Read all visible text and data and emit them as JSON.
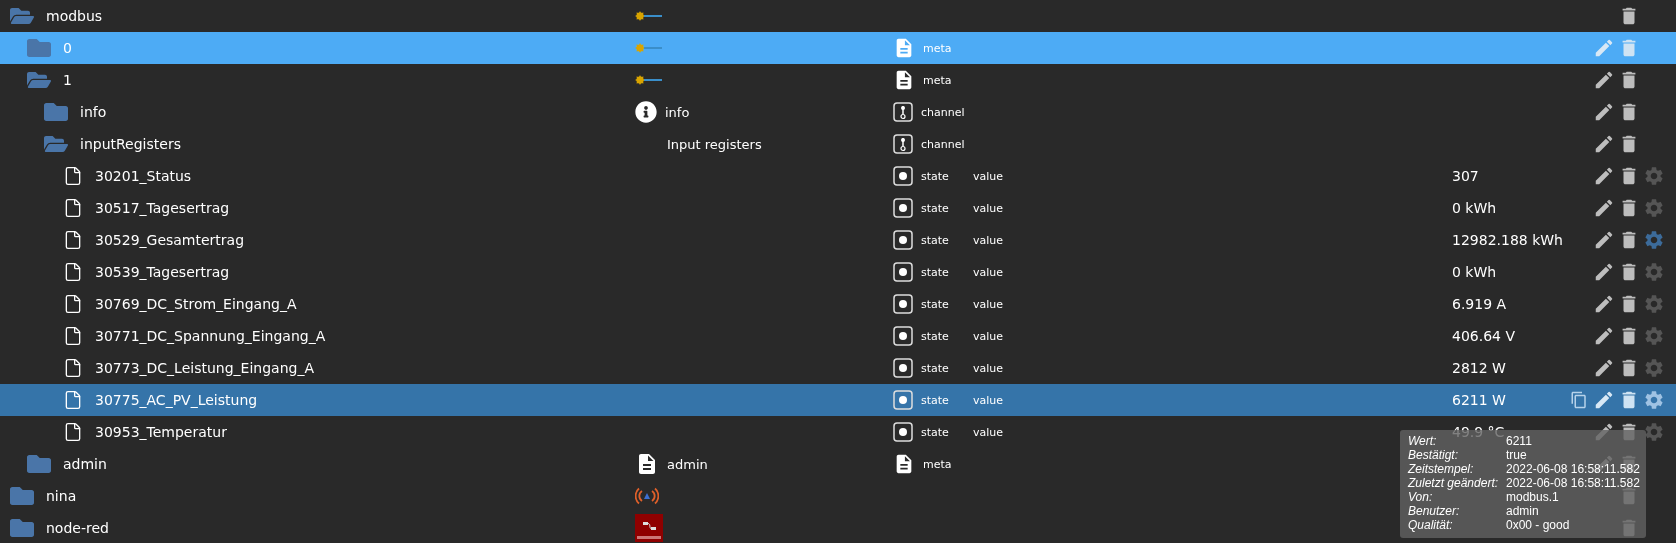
{
  "objects": [
    {
      "name": "modbus",
      "kind": "folder",
      "expanded": true,
      "selected": false,
      "hovered": false,
      "icon": {
        "kind": "logo"
      },
      "editable": false,
      "children": [
        {
          "name": "0",
          "kind": "folder",
          "expanded": false,
          "selected": true,
          "hovered": false,
          "icon": {
            "kind": "logo"
          },
          "type": {
            "kind": "meta",
            "label": "meta"
          },
          "editable": true
        },
        {
          "name": "1",
          "kind": "folder",
          "expanded": true,
          "selected": false,
          "hovered": false,
          "icon": {
            "kind": "logo"
          },
          "type": {
            "kind": "meta",
            "label": "meta"
          },
          "editable": true,
          "children": [
            {
              "name": "info",
              "kind": "folder",
              "expanded": false,
              "selected": false,
              "hovered": false,
              "icon": {
                "kind": "info",
                "label": "info"
              },
              "type": {
                "kind": "channel",
                "label": "channel"
              },
              "editable": true
            },
            {
              "name": "inputRegisters",
              "kind": "folder",
              "expanded": true,
              "selected": false,
              "hovered": false,
              "icon": {
                "kind": "none",
                "label": "Input registers"
              },
              "type": {
                "kind": "channel",
                "label": "channel"
              },
              "editable": true,
              "children": [
                {
                  "name": "30201_Status",
                  "kind": "state",
                  "selected": false,
                  "hovered": false,
                  "type": {
                    "kind": "state",
                    "label": "state"
                  },
                  "role": "value",
                  "value": "307",
                  "editable": true,
                  "settings": true,
                  "custom": false
                },
                {
                  "name": "30517_Tagesertrag",
                  "kind": "state",
                  "selected": false,
                  "hovered": false,
                  "type": {
                    "kind": "state",
                    "label": "state"
                  },
                  "role": "value",
                  "value": "0 kWh",
                  "editable": true,
                  "settings": true,
                  "custom": false
                },
                {
                  "name": "30529_Gesamtertrag",
                  "kind": "state",
                  "selected": false,
                  "hovered": false,
                  "type": {
                    "kind": "state",
                    "label": "state"
                  },
                  "role": "value",
                  "value": "12982.188 kWh",
                  "editable": true,
                  "settings": true,
                  "custom": true
                },
                {
                  "name": "30539_Tagesertrag",
                  "kind": "state",
                  "selected": false,
                  "hovered": false,
                  "type": {
                    "kind": "state",
                    "label": "state"
                  },
                  "role": "value",
                  "value": "0 kWh",
                  "editable": true,
                  "settings": true,
                  "custom": false
                },
                {
                  "name": "30769_DC_Strom_Eingang_A",
                  "kind": "state",
                  "selected": false,
                  "hovered": false,
                  "type": {
                    "kind": "state",
                    "label": "state"
                  },
                  "role": "value",
                  "value": "6.919 A",
                  "editable": true,
                  "settings": true,
                  "custom": false
                },
                {
                  "name": "30771_DC_Spannung_Eingang_A",
                  "kind": "state",
                  "selected": false,
                  "hovered": false,
                  "type": {
                    "kind": "state",
                    "label": "state"
                  },
                  "role": "value",
                  "value": "406.64 V",
                  "editable": true,
                  "settings": true,
                  "custom": false
                },
                {
                  "name": "30773_DC_Leistung_Eingang_A",
                  "kind": "state",
                  "selected": false,
                  "hovered": false,
                  "type": {
                    "kind": "state",
                    "label": "state"
                  },
                  "role": "value",
                  "value": "2812 W",
                  "editable": true,
                  "settings": true,
                  "custom": false
                },
                {
                  "name": "30775_AC_PV_Leistung",
                  "kind": "state",
                  "selected": false,
                  "hovered": true,
                  "type": {
                    "kind": "state",
                    "label": "state"
                  },
                  "role": "value",
                  "value": "6211 W",
                  "editable": true,
                  "settings": true,
                  "custom": false
                },
                {
                  "name": "30953_Temperatur",
                  "kind": "state",
                  "selected": false,
                  "hovered": false,
                  "type": {
                    "kind": "state",
                    "label": "state"
                  },
                  "role": "value",
                  "value": "49.9 °C",
                  "editable": true,
                  "settings": true,
                  "custom": false
                }
              ]
            }
          ]
        },
        {
          "name": "admin",
          "kind": "folder",
          "expanded": false,
          "selected": false,
          "hovered": false,
          "icon": {
            "kind": "document",
            "label": "admin"
          },
          "type": {
            "kind": "meta",
            "label": "meta"
          },
          "editable": true
        }
      ]
    },
    {
      "name": "nina",
      "kind": "folder",
      "expanded": false,
      "selected": false,
      "hovered": false,
      "icon": {
        "kind": "broadcast"
      },
      "editable": false
    },
    {
      "name": "node-red",
      "kind": "folder",
      "expanded": false,
      "selected": false,
      "hovered": false,
      "icon": {
        "kind": "flow"
      },
      "editable": false
    }
  ],
  "tooltip": {
    "rows": [
      {
        "label": "Wert:",
        "value": "6211"
      },
      {
        "label": "Bestätigt:",
        "value": "true"
      },
      {
        "label": "Zeitstempel:",
        "value": "2022-06-08 16:58:11.582"
      },
      {
        "label": "Zuletzt geändert:",
        "value": "2022-06-08 16:58:11.582"
      },
      {
        "label": "Von:",
        "value": "modbus.1"
      },
      {
        "label": "Benutzer:",
        "value": "admin"
      },
      {
        "label": "Qualität:",
        "value": "0x00 - good"
      }
    ]
  }
}
